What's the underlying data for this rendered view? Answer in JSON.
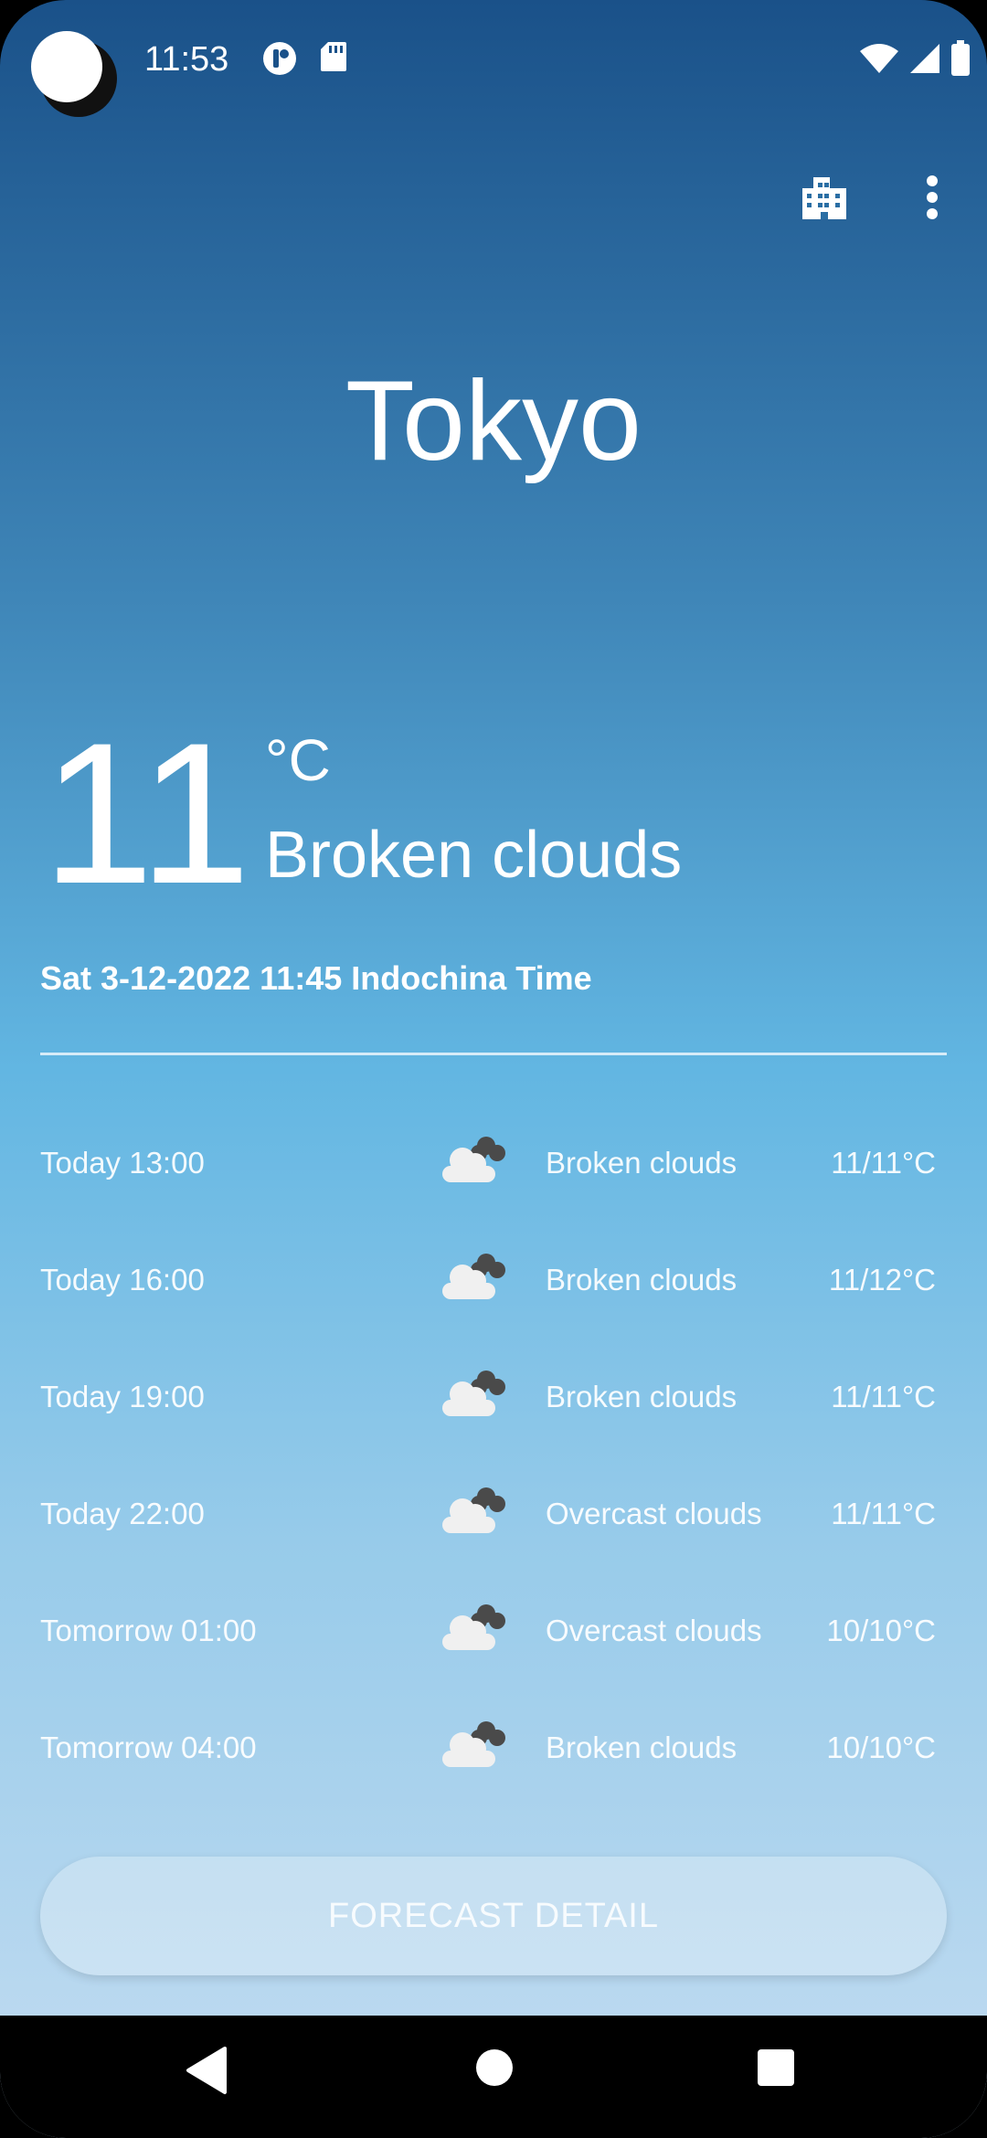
{
  "status_bar": {
    "time": "11:53",
    "icons": [
      "camera-cutout",
      "notification-app-icon",
      "sd-card-icon",
      "wifi-icon",
      "signal-icon",
      "battery-icon"
    ]
  },
  "toolbar": {
    "icons": [
      "city-icon",
      "more-vert-icon"
    ]
  },
  "city": "Tokyo",
  "current": {
    "temperature": "11",
    "unit": "°C",
    "condition": "Broken clouds",
    "datetime": "Sat 3-12-2022 11:45 Indochina Time"
  },
  "forecast": [
    {
      "time": "Today 13:00",
      "condition": "Broken clouds",
      "range": "11/11°C"
    },
    {
      "time": "Today 16:00",
      "condition": "Broken clouds",
      "range": "11/12°C"
    },
    {
      "time": "Today 19:00",
      "condition": "Broken clouds",
      "range": "11/11°C"
    },
    {
      "time": "Today 22:00",
      "condition": "Overcast clouds",
      "range": "11/11°C"
    },
    {
      "time": "Tomorrow 01:00",
      "condition": "Overcast clouds",
      "range": "10/10°C"
    },
    {
      "time": "Tomorrow 04:00",
      "condition": "Broken clouds",
      "range": "10/10°C"
    }
  ],
  "detail_button": "FORECAST DETAIL",
  "nav": {
    "icons": [
      "back-icon",
      "home-icon",
      "recents-icon"
    ]
  },
  "colors": {
    "gradient_top": "#1a5189",
    "gradient_mid": "#62b6e2",
    "gradient_bottom": "#c3dcf1",
    "text": "#ffffff"
  }
}
